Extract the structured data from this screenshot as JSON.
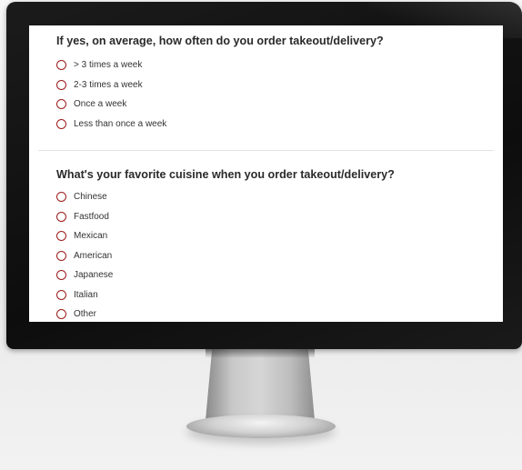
{
  "survey": {
    "question1": {
      "title": "If yes, on average, how often do you order takeout/delivery?",
      "options": [
        "> 3 times a week",
        "2-3 times a week",
        "Once a week",
        "Less than once a week"
      ]
    },
    "question2": {
      "title": "What's your favorite cuisine when you order takeout/delivery?",
      "options": [
        "Chinese",
        "Fastfood",
        "Mexican",
        "American",
        "Japanese",
        "Italian",
        "Other"
      ]
    }
  },
  "colors": {
    "radio_border": "#9b1b1b",
    "question_text": "#2a2a2a",
    "option_text": "#333333",
    "screen_background": "#ffffff",
    "bezel": "#111111"
  },
  "icons": {
    "option_radio": "radio-button-icon"
  }
}
